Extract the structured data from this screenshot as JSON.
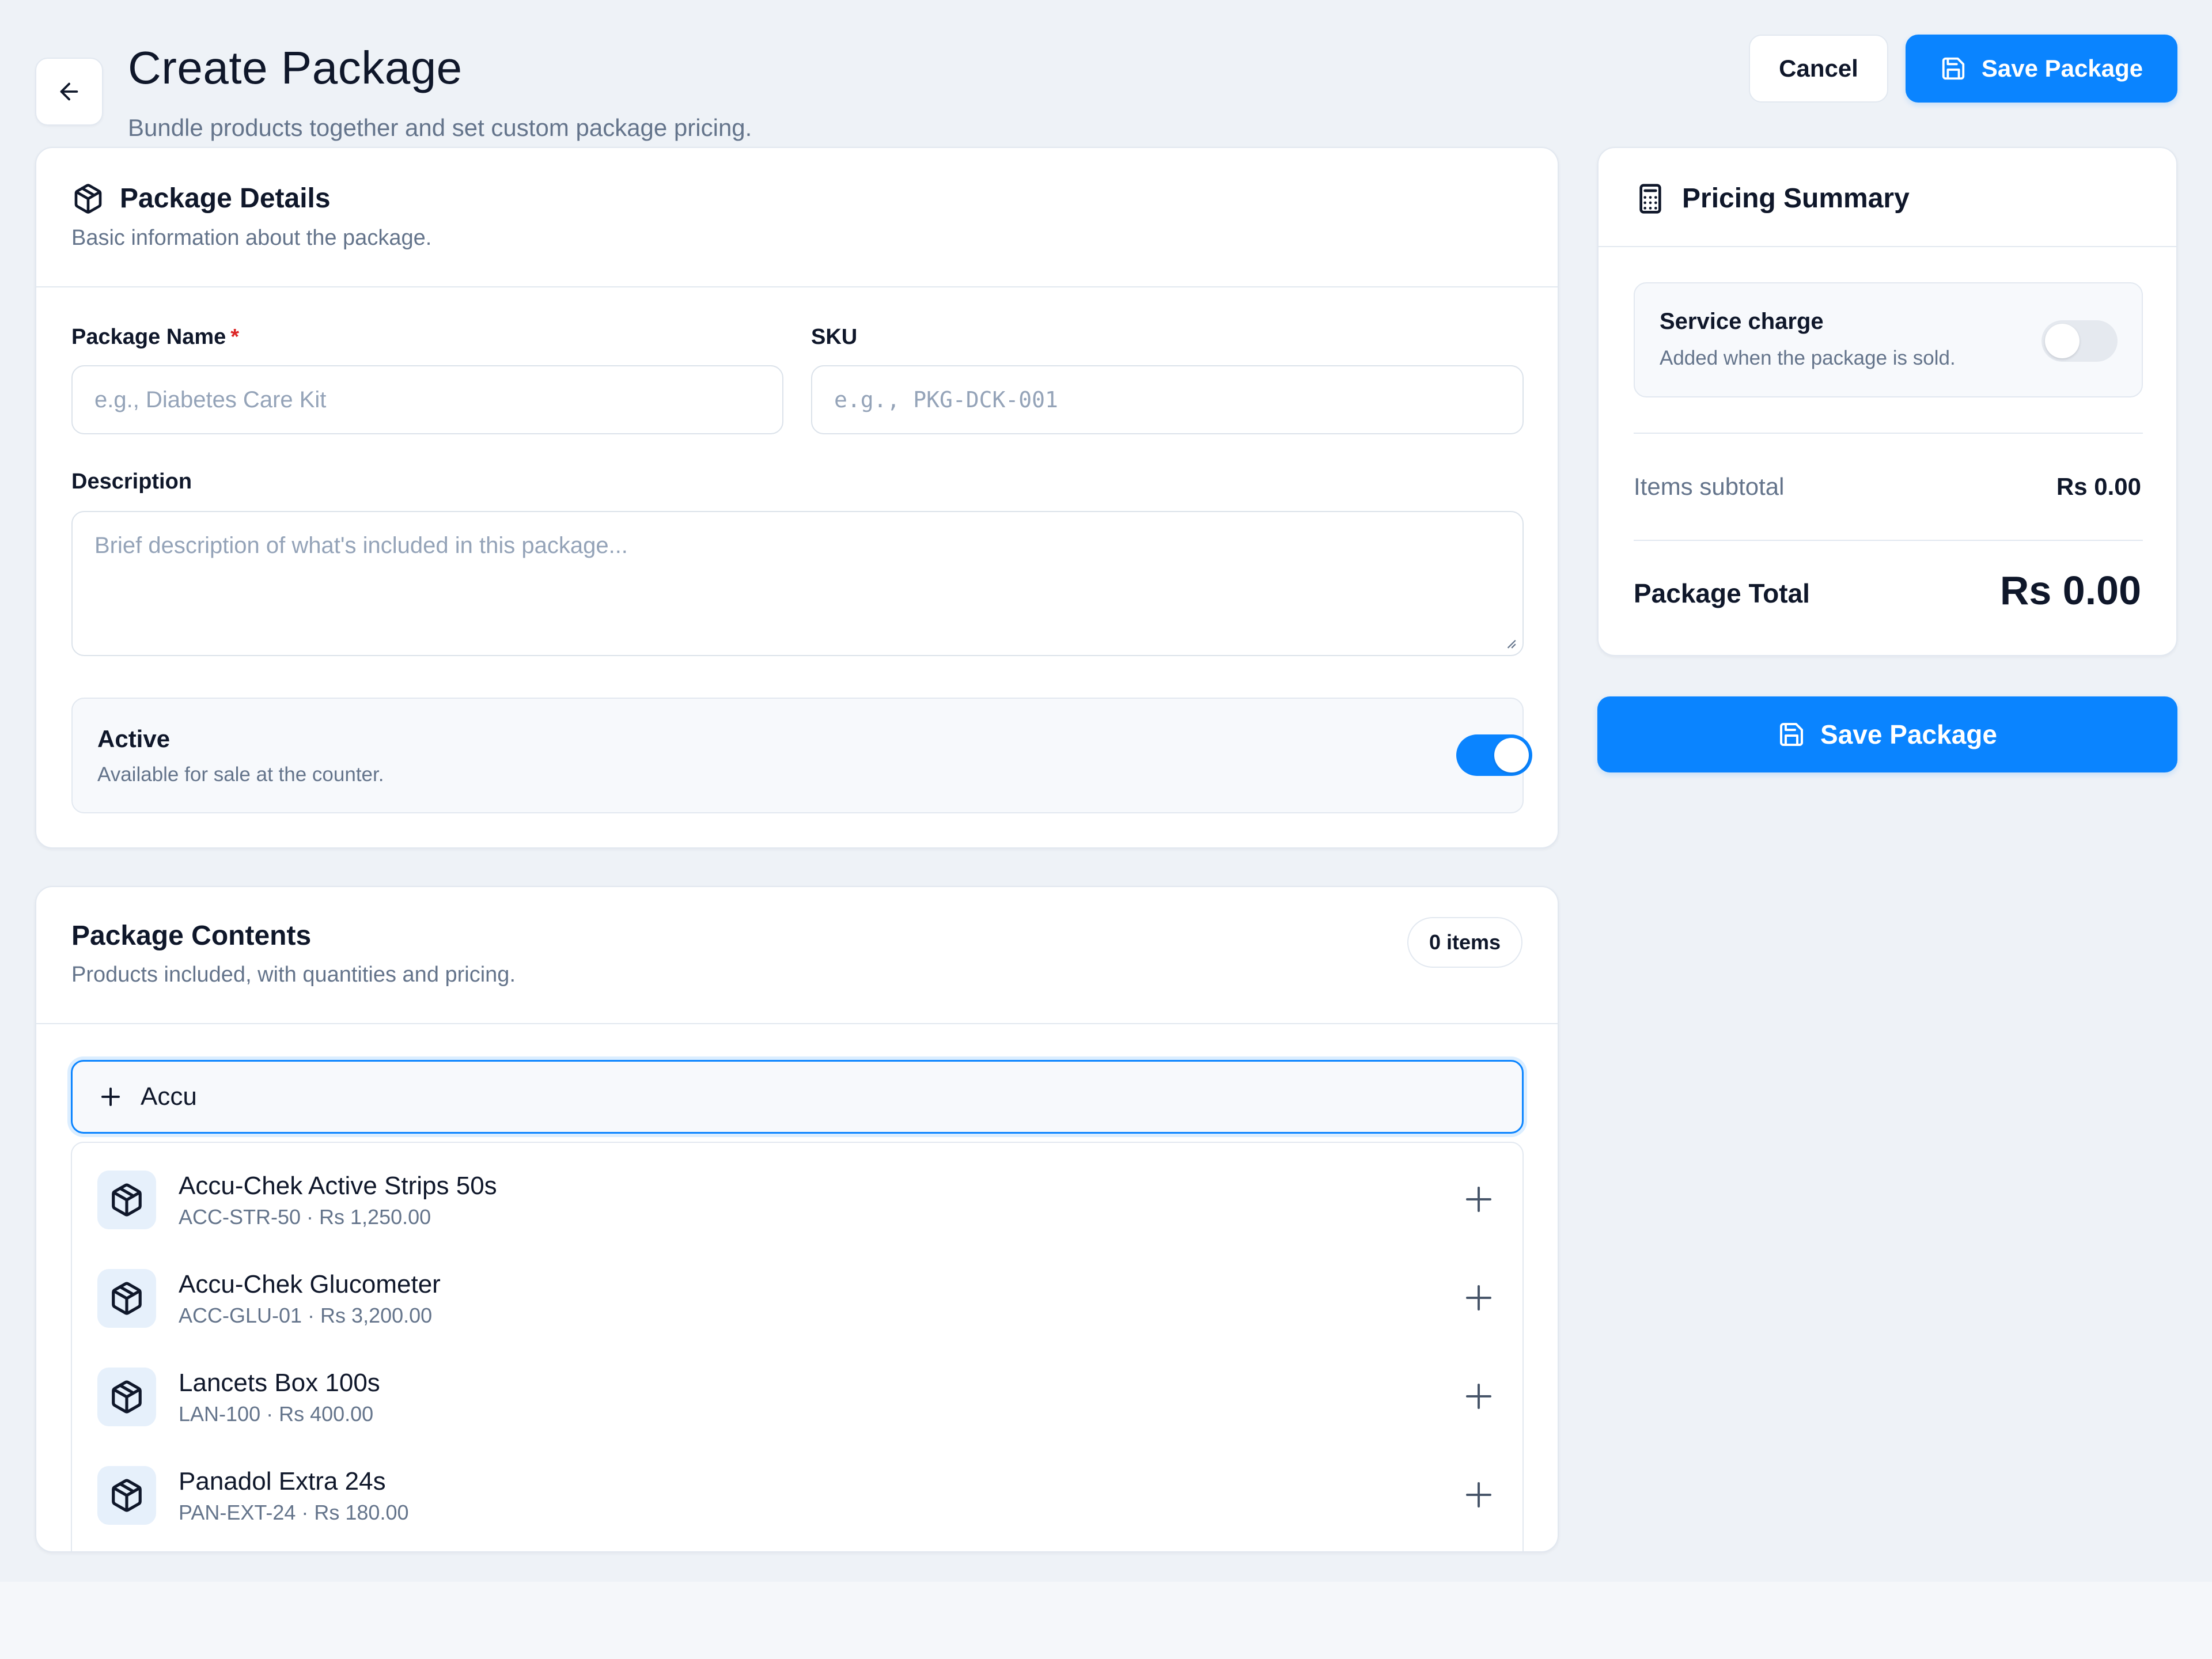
{
  "header": {
    "back_label": "Back",
    "title": "Create Package",
    "subtitle": "Bundle products together and set custom package pricing.",
    "cancel_label": "Cancel",
    "save_label": "Save Package"
  },
  "details": {
    "title": "Package Details",
    "subtitle": "Basic information about the package.",
    "name_label": "Package Name",
    "name_required": "*",
    "name_placeholder": "e.g., Diabetes Care Kit",
    "name_value": "",
    "sku_label": "SKU",
    "sku_placeholder": "e.g., PKG-DCK-001",
    "sku_value": "",
    "description_label": "Description",
    "description_placeholder": "Brief description of what's included in this package...",
    "description_value": "",
    "active_title": "Active",
    "active_sub": "Available for sale at the counter.",
    "active_on": true
  },
  "contents": {
    "title": "Package Contents",
    "subtitle": "Products included, with quantities and pricing.",
    "count_badge": "0 items",
    "search_value": "Accu",
    "results": [
      {
        "name": "Accu-Chek Active Strips 50s",
        "meta": "ACC-STR-50 · Rs 1,250.00",
        "icon": "box-icon"
      },
      {
        "name": "Accu-Chek Glucometer",
        "meta": "ACC-GLU-01 · Rs 3,200.00",
        "icon": "box-icon"
      },
      {
        "name": "Lancets Box 100s",
        "meta": "LAN-100 · Rs 400.00",
        "icon": "box-icon"
      },
      {
        "name": "Panadol Extra 24s",
        "meta": "PAN-EXT-24 · Rs 180.00",
        "icon": "box-icon"
      }
    ]
  },
  "pricing": {
    "title": "Pricing Summary",
    "service_title": "Service charge",
    "service_sub": "Added when the package is sold.",
    "service_on": false,
    "subtotal_label": "Items subtotal",
    "subtotal_value": "Rs 0.00",
    "total_label": "Package Total",
    "total_value": "Rs 0.00",
    "save_label": "Save Package"
  },
  "colors": {
    "accent": "#0a84ff",
    "required": "#dc2626",
    "background": "#eef2f7",
    "muted_text": "#64748b"
  }
}
